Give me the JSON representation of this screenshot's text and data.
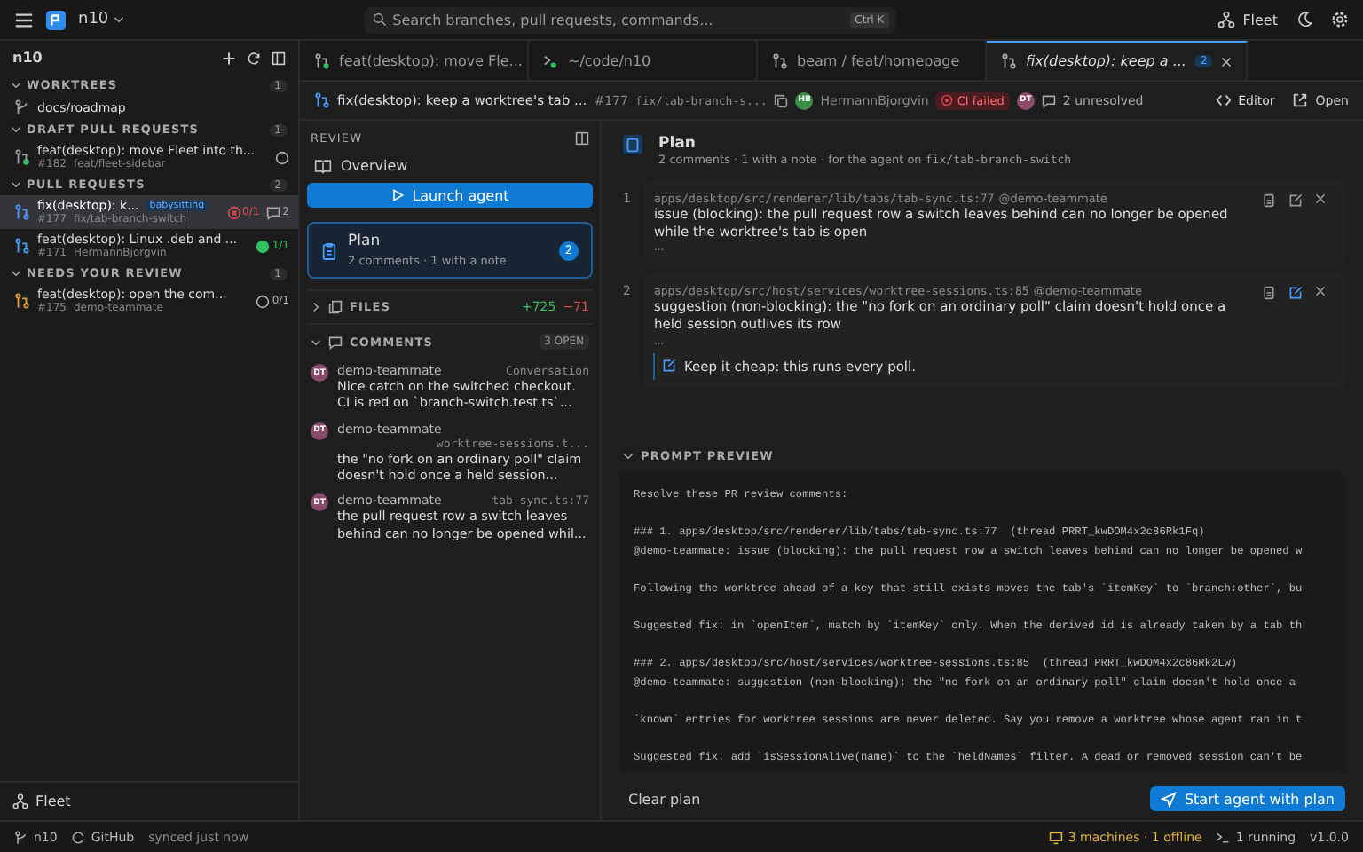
{
  "topbar": {
    "workspace": "n10",
    "search": {
      "placeholder": "Search branches, pull requests, commands...",
      "shortcut": "Ctrl K"
    },
    "fleet": "Fleet"
  },
  "sidebar": {
    "title": "n10",
    "sections": [
      {
        "title": "WORKTREES",
        "count": "1",
        "expanded": true,
        "items": [
          {
            "kind": "worktree",
            "title": "docs/roadmap",
            "selected": false
          }
        ]
      },
      {
        "title": "DRAFT PULL REQUESTS",
        "count": "1",
        "expanded": true,
        "items": [
          {
            "kind": "draft",
            "title": "feat(desktop): move Fleet into th...",
            "number": "#182",
            "sub": "feat/fleet-sidebar",
            "failing": false,
            "passing": false,
            "selected": false
          }
        ]
      },
      {
        "title": "PULL REQUESTS",
        "count": "2",
        "expanded": true,
        "items": [
          {
            "kind": "open",
            "title": "fix(desktop): k...",
            "badge": "babysitting",
            "number": "#177",
            "sub": "fix/tab-branch-switch",
            "failing": true,
            "passing": false,
            "checks": "0/1",
            "comments": "2",
            "selected": true
          },
          {
            "kind": "open",
            "title": "feat(desktop): Linux .deb and ...",
            "number": "#171",
            "sub": "HermannBjorgvin",
            "failing": false,
            "passing": true,
            "checks": "1/1",
            "selected": false
          }
        ]
      },
      {
        "title": "NEEDS YOUR REVIEW",
        "count": "1",
        "expanded": true,
        "items": [
          {
            "kind": "review",
            "title": "feat(desktop): open the com...",
            "number": "#175",
            "sub": "demo-teammate",
            "failing": false,
            "passing": false,
            "checks": "0/1",
            "selected": false
          }
        ]
      }
    ],
    "footer": "Fleet"
  },
  "tabs": [
    {
      "kind": "branch",
      "label": "feat(desktop): move Fle...",
      "selected": false
    },
    {
      "kind": "terminal",
      "label": "~/code/n10",
      "selected": false
    },
    {
      "kind": "worktree",
      "label": "beam / feat/homepage",
      "selected": false
    },
    {
      "kind": "pr",
      "label": "fix(desktop): keep a ...",
      "badge": "2",
      "selected": true
    }
  ],
  "pr_header": {
    "title": "fix(desktop): keep a worktree's tab ...",
    "number": "#177",
    "branch": "fix/tab-branch-s...",
    "author_initials": "HB",
    "author": "HermannBjorgvin",
    "ci": "CI failed",
    "reviewer_initials": "DT",
    "unresolved": "2 unresolved",
    "editor": "Editor",
    "open": "Open"
  },
  "review": {
    "title": "REVIEW",
    "overview": "Overview",
    "launch": "Launch agent",
    "plan": {
      "title": "Plan",
      "subtitle": "2 comments · 1 with a note",
      "count": "2",
      "selected": true
    },
    "files": {
      "title": "FILES",
      "expanded": false,
      "added": "+725",
      "removed": "−71"
    },
    "comments": {
      "title": "COMMENTS",
      "expanded": true,
      "count": "3 OPEN",
      "items": [
        {
          "initials": "DT",
          "author": "demo-teammate",
          "location": "Conversation",
          "text": "Nice catch on the switched checkout. CI is red on `branch-switch.test.ts`..."
        },
        {
          "initials": "DT",
          "author": "demo-teammate",
          "location": "worktree-sessions.t...",
          "text": "the \"no fork on an ordinary poll\" claim doesn't hold once a held session..."
        },
        {
          "initials": "DT",
          "author": "demo-teammate",
          "location": "tab-sync.ts:77",
          "text": "the pull request row a switch leaves behind can no longer be opened whil..."
        }
      ]
    }
  },
  "plan": {
    "title": "Plan",
    "subtitle": "2 comments · 1 with a note · for the agent on",
    "branch": "fix/tab-branch-switch",
    "items": [
      {
        "number": "1",
        "path": "apps/desktop/src/renderer/lib/tabs/tab-sync.ts:77",
        "author": "@demo-teammate",
        "text": "issue (blocking): the pull request row a switch leaves behind can no longer be opened while the worktree's tab is open",
        "more": "..."
      },
      {
        "number": "2",
        "path": "apps/desktop/src/host/services/worktree-sessions.ts:85",
        "author": "@demo-teammate",
        "text": "suggestion (non-blocking): the \"no fork on an ordinary poll\" claim doesn't hold once a held session outlives its row",
        "more": "...",
        "note": "Keep it cheap: this runs every poll."
      }
    ]
  },
  "prompt_preview": {
    "title": "PROMPT PREVIEW",
    "expanded": true,
    "paragraphs": [
      [
        "Resolve these PR review comments:"
      ],
      [
        "### 1. apps/desktop/src/renderer/lib/tabs/tab-sync.ts:77  (thread PRRT_kwDOM4x2c86Rk1Fq)",
        "@demo-teammate: issue (blocking): the pull request row a switch leaves behind can no longer be opened w"
      ],
      [
        "Following the worktree ahead of a key that still exists moves the tab's `itemKey` to `branch:other`, bu"
      ],
      [
        "Suggested fix: in `openItem`, match by `itemKey` only. When the derived id is already taken by a tab th"
      ],
      [
        "### 2. apps/desktop/src/host/services/worktree-sessions.ts:85  (thread PRRT_kwDOM4x2c86Rk2Lw)",
        "@demo-teammate: suggestion (non-blocking): the \"no fork on an ordinary poll\" claim doesn't hold once a"
      ],
      [
        "`known` entries for worktree sessions are never deleted. Say you remove a worktree whose agent ran in t"
      ],
      [
        "Suggested fix: add `isSessionAlive(name)` to the `heldNames` filter. A dead or removed session can't be"
      ]
    ]
  },
  "actions": {
    "clear": "Clear plan",
    "start": "Start agent with plan"
  },
  "status_bar": {
    "branch": "n10",
    "provider": "GitHub",
    "synced": "synced just now",
    "machines": "3 machines · 1 offline",
    "running": "1 running",
    "version": "v1.0.0"
  }
}
